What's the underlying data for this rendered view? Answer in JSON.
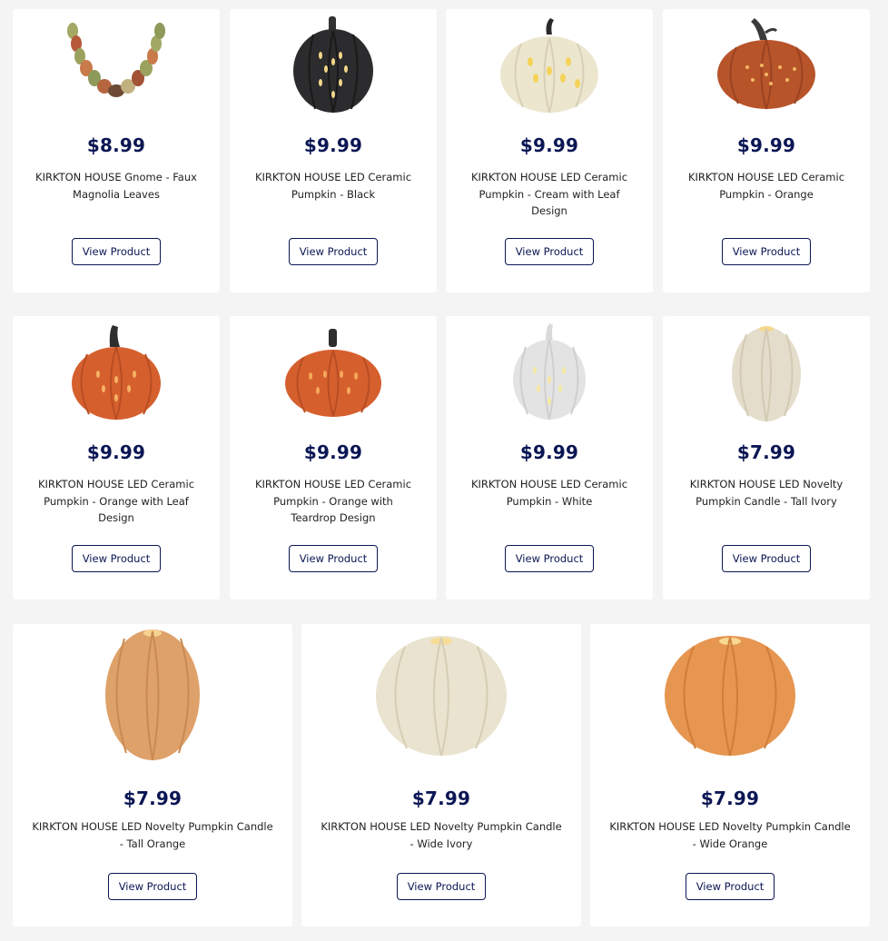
{
  "products": [
    {
      "price": "$8.99",
      "name": "KIRKTON HOUSE Gnome - Faux Magnolia Leaves",
      "button": "View Product",
      "icon": "garland-image"
    },
    {
      "price": "$9.99",
      "name": "KIRKTON HOUSE LED Ceramic Pumpkin - Black",
      "button": "View Product",
      "icon": "pumpkin-black-image"
    },
    {
      "price": "$9.99",
      "name": "KIRKTON HOUSE LED Ceramic Pumpkin - Cream with Leaf Design",
      "button": "View Product",
      "icon": "pumpkin-cream-leaf-image"
    },
    {
      "price": "$9.99",
      "name": "KIRKTON HOUSE LED Ceramic Pumpkin - Orange",
      "button": "View Product",
      "icon": "pumpkin-orange-image"
    },
    {
      "price": "$9.99",
      "name": "KIRKTON HOUSE LED Ceramic Pumpkin - Orange with Leaf Design",
      "button": "View Product",
      "icon": "pumpkin-orange-leaf-image"
    },
    {
      "price": "$9.99",
      "name": "KIRKTON HOUSE LED Ceramic Pumpkin - Orange with Teardrop Design",
      "button": "View Product",
      "icon": "pumpkin-orange-teardrop-image"
    },
    {
      "price": "$9.99",
      "name": "KIRKTON HOUSE LED Ceramic Pumpkin - White",
      "button": "View Product",
      "icon": "pumpkin-white-image"
    },
    {
      "price": "$7.99",
      "name": "KIRKTON HOUSE LED Novelty Pumpkin Candle - Tall Ivory",
      "button": "View Product",
      "icon": "candle-tall-ivory-image"
    },
    {
      "price": "$7.99",
      "name": "KIRKTON HOUSE LED Novelty Pumpkin Candle - Tall Orange",
      "button": "View Product",
      "icon": "candle-tall-orange-image"
    },
    {
      "price": "$7.99",
      "name": "KIRKTON HOUSE LED Novelty Pumpkin Candle - Wide Ivory",
      "button": "View Product",
      "icon": "candle-wide-ivory-image"
    },
    {
      "price": "$7.99",
      "name": "KIRKTON HOUSE LED Novelty Pumpkin Candle - Wide Orange",
      "button": "View Product",
      "icon": "candle-wide-orange-image"
    }
  ],
  "colors": {
    "accent": "#0b1654",
    "card": "#ffffff",
    "background": "#f4f4f4"
  }
}
